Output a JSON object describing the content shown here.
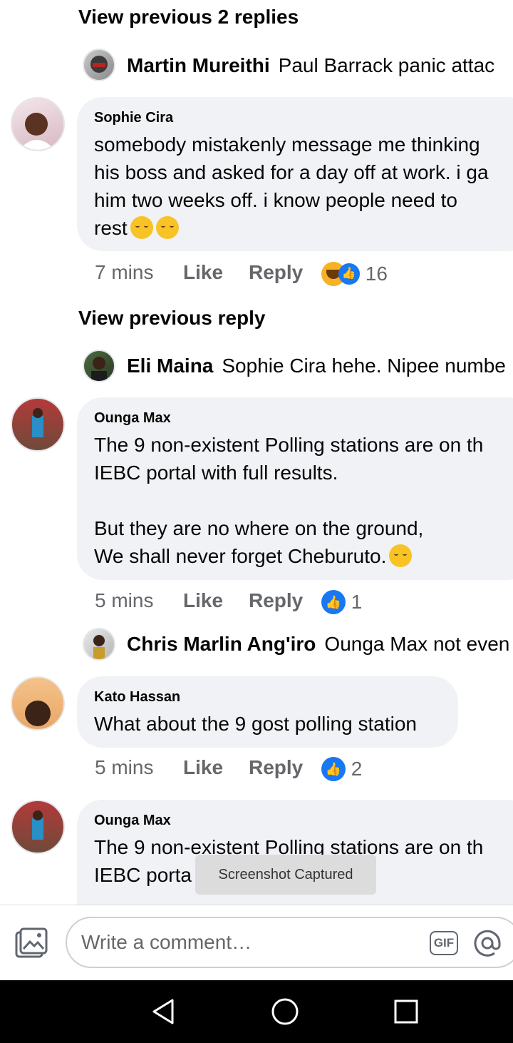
{
  "thread1": {
    "view_previous": "View previous 2 replies",
    "reply": {
      "name": "Martin Mureithi",
      "text": "Paul Barrack panic attac"
    },
    "comment": {
      "author": "Sophie Cira",
      "text": "somebody mistakenly message me thinking\nhis boss and asked for a day off at work. i ga\nhim two weeks off. i know people need to\nrest",
      "time": "7 mins",
      "like": "Like",
      "reply": "Reply",
      "reaction_count": "16"
    }
  },
  "thread2": {
    "view_previous": "View previous reply",
    "reply": {
      "name": "Eli Maina",
      "text": "Sophie Cira hehe. Nipee numbe"
    },
    "comment": {
      "author": "Ounga Max",
      "text": "The 9 non-existent  Polling stations are on th\nIEBC portal with full results.\n\nBut they are no where on the ground,\nWe shall never forget Cheburuto.",
      "time": "5 mins",
      "like": "Like",
      "reply": "Reply",
      "reaction_count": "1"
    }
  },
  "thread3": {
    "reply": {
      "name": "Chris Marlin Ang'iro",
      "text": "Ounga Max not even"
    },
    "comment": {
      "author": "Kato Hassan",
      "text": "What about the 9 gost polling station",
      "time": "5 mins",
      "like": "Like",
      "reply": "Reply",
      "reaction_count": "2"
    }
  },
  "thread4": {
    "comment": {
      "author": "Ounga Max",
      "text": "The 9 non-existent  Polling stations are on th\nIEBC porta"
    }
  },
  "toast": "Screenshot Captured",
  "composer": {
    "placeholder": "Write a comment…",
    "gif_label": "GIF"
  },
  "colors": {
    "like_blue": "#1877f2",
    "bubble_bg": "#f0f2f5",
    "meta_gray": "#65676b"
  },
  "icons": [
    "photo-icon",
    "gif-icon",
    "mention-icon",
    "back-icon",
    "home-icon",
    "recents-icon",
    "like-icon",
    "haha-icon"
  ]
}
